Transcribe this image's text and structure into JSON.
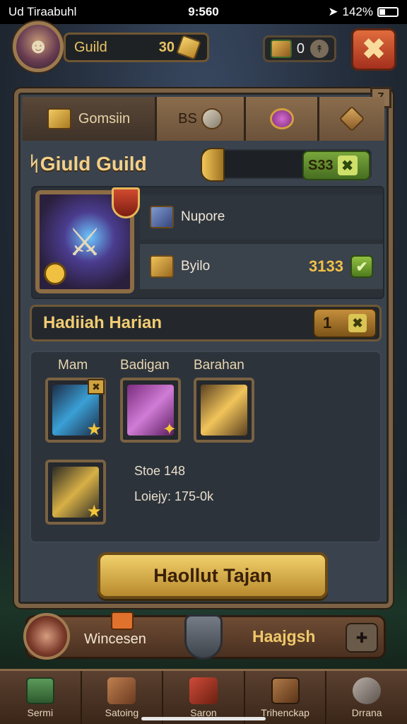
{
  "status_bar": {
    "carrier": "Ud Tiraabuhl",
    "time": "9:560",
    "battery": "142%"
  },
  "hud": {
    "guild_label": "Guild",
    "guild_value": "30",
    "resource_value": "0"
  },
  "tabs": [
    {
      "label": "Gomsiin",
      "icon": "gold-chest-icon"
    },
    {
      "label": "BS",
      "icon": "gear-icon"
    },
    {
      "label": "",
      "icon": "magnifier-icon"
    },
    {
      "label": "",
      "icon": "star-badge-icon"
    }
  ],
  "guild": {
    "title": "ᛋGiuld Guild",
    "score": "S33",
    "info": [
      {
        "label": "Nupore",
        "value": "",
        "icon": "sword-icon"
      },
      {
        "label": "Byilo",
        "value": "3133",
        "icon": "gold-card-icon"
      }
    ]
  },
  "daily": {
    "title": "Hadiiah Harian",
    "count": "1"
  },
  "rewards": {
    "labels": [
      "Mam",
      "Badigan",
      "Barahan"
    ],
    "stats": [
      "Stoe 148",
      "Loiejy: 175-0k"
    ]
  },
  "claim_button": "Haollut Tajan",
  "player": {
    "name": "Wincesen",
    "action": "Haajgsh"
  },
  "nav": [
    {
      "label": "Sermi",
      "icon": "home-icon"
    },
    {
      "label": "Satoing",
      "icon": "boots-icon"
    },
    {
      "label": "Saron",
      "icon": "helmet-icon"
    },
    {
      "label": "Trihenckap",
      "icon": "book-icon"
    },
    {
      "label": "Drrana",
      "icon": "swirl-icon"
    }
  ],
  "colors": {
    "accent": "#f2cc72",
    "panel": "#3a434d",
    "border": "#7b6244",
    "close": "#c84a28"
  }
}
